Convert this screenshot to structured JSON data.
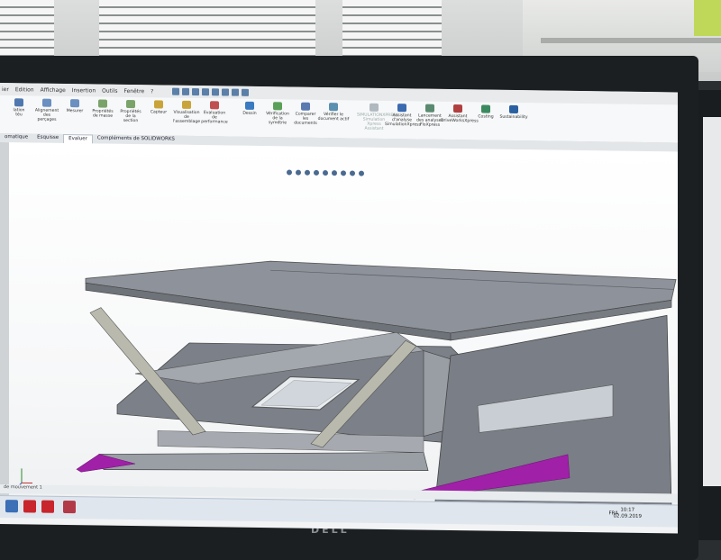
{
  "menu": {
    "items": [
      "ier",
      "Edition",
      "Affichage",
      "Insertion",
      "Outils",
      "Fenêtre",
      "?"
    ]
  },
  "ribbon": {
    "buttons": [
      {
        "label": "lation\ntéu",
        "color": "#4f78b0"
      },
      {
        "label": "Alignement\ndes\nperçages",
        "color": "#6a8fc0"
      },
      {
        "label": "Mesurer",
        "color": "#6a8fc0"
      },
      {
        "label": "Propriétés\nde masse",
        "color": "#7aa36a"
      },
      {
        "label": "Propriétés\nde la\nsection",
        "color": "#7aa36a"
      },
      {
        "label": "Capteur",
        "color": "#c9a43a"
      },
      {
        "label": "Visualisation\nde\nl'assemblage",
        "color": "#c9a43a"
      },
      {
        "label": "Evaluation\nde\nperformance",
        "color": "#c05050"
      },
      {
        "label": "Dessin",
        "color": "#3a7ac0"
      },
      {
        "label": "Vérification\nde la\nsymétrie",
        "color": "#5aa05a"
      },
      {
        "label": "Comparer\nles\ndocuments",
        "color": "#5a7ab0"
      },
      {
        "label": "Vérifier le\ndocument actif",
        "color": "#5a90b0"
      },
      {
        "label": "SIMULATIONXPRESS\nSimulation\nXpress\nAssistant",
        "color": "#b0b8c0",
        "disabled": true
      },
      {
        "label": "Assistant\nd'analyse\nSimulationXpress",
        "color": "#3a6ab0"
      },
      {
        "label": "Lancement\ndes analyses\nFloXpress",
        "color": "#5a8a70"
      },
      {
        "label": "Assistant\nDriveWorksXpress",
        "color": "#b04040"
      },
      {
        "label": "Costing",
        "color": "#3a8a60"
      },
      {
        "label": "Sustainability",
        "color": "#2a60a0"
      }
    ]
  },
  "tabs": [
    {
      "label": "omatique"
    },
    {
      "label": "Esquisse"
    },
    {
      "label": "Evaluer",
      "active": true
    },
    {
      "label": "Compléments de SOLIDWORKS"
    }
  ],
  "status": {
    "text": "de mouvement 1"
  },
  "taskbar": {
    "lang": "FRA",
    "time": "10:17",
    "date": "02.09.2019"
  },
  "monitor": {
    "logo": "DELL"
  },
  "colors": {
    "model_gray": "#7c8088",
    "model_dark": "#5c6068",
    "model_light": "#a8acb4",
    "beam": "#b9b9ad",
    "purple": "#a020a8",
    "window": "#d8dde3"
  }
}
